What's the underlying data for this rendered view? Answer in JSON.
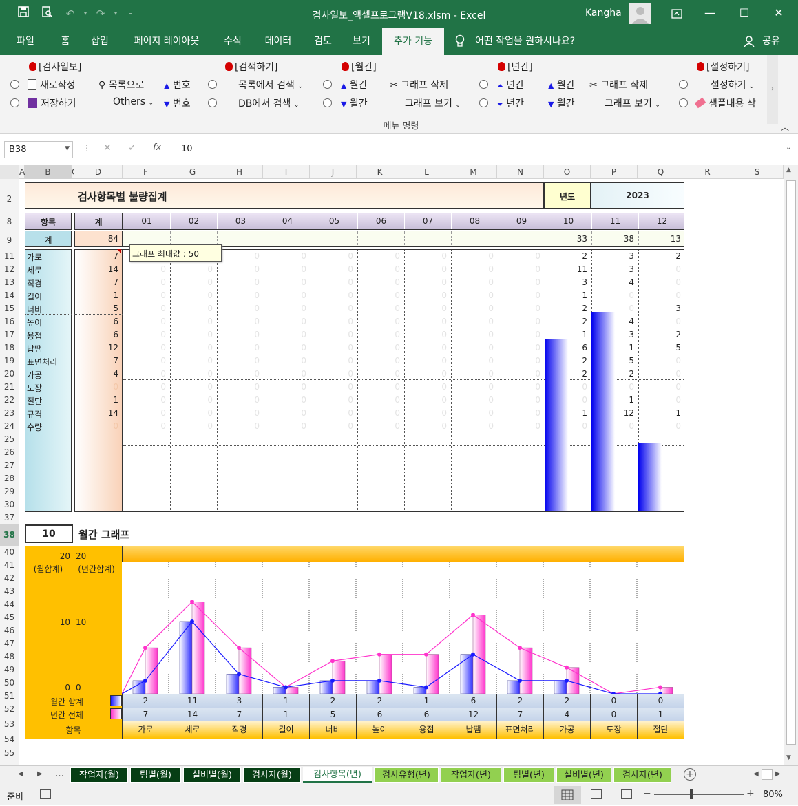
{
  "window": {
    "title": "검사일보_액셀프로그램V18.xlsm  -  Excel",
    "user": "Kangha"
  },
  "tabs": [
    "파일",
    "홈",
    "삽입",
    "페이지 레이아웃",
    "수식",
    "데이터",
    "검토",
    "보기",
    "추가 기능"
  ],
  "tell_me": "어떤 작업을 원하시나요?",
  "share": "공유",
  "ribbon": {
    "group_label": "메뉴 명령",
    "g1": {
      "title": "[검사일보]",
      "new": "새로작성",
      "save": "저장하기",
      "list": "목록으로",
      "others": "Others",
      "num_up": "번호",
      "num_down": "번호"
    },
    "g2": {
      "title": "[검색하기]",
      "list_search": "목록에서 검색",
      "db_search": "DB에서 검색"
    },
    "g3": {
      "title": "[월간]",
      "m_up": "월간",
      "m_down": "월간",
      "del_graph": "그래프 삭제",
      "view_graph": "그래프 보기"
    },
    "g4": {
      "title": "[년간]",
      "y_up": "년간",
      "y_down": "년간",
      "m_up": "월간",
      "m_down": "월간",
      "del_graph": "그래프 삭제",
      "view_graph": "그래프 보기"
    },
    "g5": {
      "title": "[설정하기]",
      "setup": "설정하기",
      "sample": "샘플내용 삭"
    }
  },
  "formula": {
    "namebox": "B38",
    "value": "10",
    "fx": "fx"
  },
  "columns": [
    "A",
    "B",
    "C",
    "D",
    "F",
    "G",
    "H",
    "I",
    "J",
    "K",
    "L",
    "M",
    "N",
    "O",
    "P",
    "Q",
    "R",
    "S"
  ],
  "rows": [
    "1",
    "2",
    "8",
    "9",
    "11",
    "12",
    "13",
    "14",
    "15",
    "16",
    "17",
    "18",
    "19",
    "20",
    "21",
    "22",
    "23",
    "24",
    "25",
    "26",
    "27",
    "28",
    "29",
    "30",
    "37",
    "38",
    "40",
    "41",
    "42",
    "43",
    "44",
    "45",
    "46",
    "47",
    "48",
    "49",
    "50",
    "51",
    "52",
    "53",
    "54",
    "55"
  ],
  "report": {
    "title": "검사항목별 불량집계",
    "year_label": "년도",
    "year": "2023",
    "hdr_item": "항목",
    "hdr_total": "계",
    "months": [
      "01",
      "02",
      "03",
      "04",
      "05",
      "06",
      "07",
      "08",
      "09",
      "10",
      "11",
      "12"
    ],
    "sum_label": "계",
    "sum_total": "84",
    "month_sums": [
      "",
      "",
      "",
      "",
      "",
      "",
      "",
      "",
      "",
      "33",
      "38",
      "13"
    ],
    "tooltip": "그래프 최대값 : 50",
    "items": [
      {
        "name": "가로",
        "total": "7",
        "m": [
          0,
          0,
          0,
          0,
          0,
          0,
          0,
          0,
          0,
          2,
          3,
          2
        ]
      },
      {
        "name": "세로",
        "total": "14",
        "m": [
          0,
          0,
          0,
          0,
          0,
          0,
          0,
          0,
          0,
          11,
          3,
          0
        ]
      },
      {
        "name": "직경",
        "total": "7",
        "m": [
          0,
          0,
          0,
          0,
          0,
          0,
          0,
          0,
          0,
          3,
          4,
          0
        ]
      },
      {
        "name": "길이",
        "total": "1",
        "m": [
          0,
          0,
          0,
          0,
          0,
          0,
          0,
          0,
          0,
          1,
          0,
          0
        ]
      },
      {
        "name": "너비",
        "total": "5",
        "m": [
          0,
          0,
          0,
          0,
          0,
          0,
          0,
          0,
          0,
          2,
          0,
          3
        ]
      },
      {
        "name": "높이",
        "total": "6",
        "m": [
          0,
          0,
          0,
          0,
          0,
          0,
          0,
          0,
          0,
          2,
          4,
          0
        ]
      },
      {
        "name": "용접",
        "total": "6",
        "m": [
          0,
          0,
          0,
          0,
          0,
          0,
          0,
          0,
          0,
          1,
          3,
          2
        ]
      },
      {
        "name": "납땜",
        "total": "12",
        "m": [
          0,
          0,
          0,
          0,
          0,
          0,
          0,
          0,
          0,
          6,
          1,
          5
        ]
      },
      {
        "name": "표면처리",
        "total": "7",
        "m": [
          0,
          0,
          0,
          0,
          0,
          0,
          0,
          0,
          0,
          2,
          5,
          0
        ]
      },
      {
        "name": "가공",
        "total": "4",
        "m": [
          0,
          0,
          0,
          0,
          0,
          0,
          0,
          0,
          0,
          2,
          2,
          0
        ]
      },
      {
        "name": "도장",
        "total": "0",
        "m": [
          0,
          0,
          0,
          0,
          0,
          0,
          0,
          0,
          0,
          0,
          0,
          0
        ]
      },
      {
        "name": "절단",
        "total": "1",
        "m": [
          0,
          0,
          0,
          0,
          0,
          0,
          0,
          0,
          0,
          0,
          1,
          0
        ]
      },
      {
        "name": "규격",
        "total": "14",
        "m": [
          0,
          0,
          0,
          0,
          0,
          0,
          0,
          0,
          0,
          1,
          12,
          1
        ]
      },
      {
        "name": "수량",
        "total": "0",
        "m": [
          0,
          0,
          0,
          0,
          0,
          0,
          0,
          0,
          0,
          0,
          0,
          0
        ]
      }
    ],
    "month_bars": [
      {
        "month": "10",
        "value": 33
      },
      {
        "month": "11",
        "value": 38
      },
      {
        "month": "12",
        "value": 13
      }
    ],
    "bar_max": 50
  },
  "graph": {
    "month": "10",
    "title": "월간 그래프",
    "axis_left": {
      "top": "20",
      "mid": "10",
      "bottom": "0",
      "label": "(월합계)"
    },
    "axis_right": {
      "top": "20",
      "mid": "10",
      "bottom": "0",
      "label": "(년간합계)"
    },
    "row_monthly": "월간 합계",
    "row_yearly": "년간 전체",
    "row_item": "항목",
    "chart_data": {
      "type": "bar",
      "categories": [
        "가로",
        "세로",
        "직경",
        "길이",
        "너비",
        "높이",
        "용접",
        "납땜",
        "표면처리",
        "가공",
        "도장",
        "절단"
      ],
      "series": [
        {
          "name": "월간 합계",
          "values": [
            2,
            11,
            3,
            1,
            2,
            2,
            1,
            6,
            2,
            2,
            0,
            0
          ]
        },
        {
          "name": "년간 전체",
          "values": [
            7,
            14,
            7,
            1,
            5,
            6,
            6,
            12,
            7,
            4,
            0,
            1
          ]
        }
      ],
      "ylim": [
        0,
        20
      ],
      "grid": true,
      "colors": {
        "monthly": "#1a1aff",
        "yearly": "#ff33cc"
      }
    }
  },
  "sheet_tabs": [
    {
      "label": "작업자(월)",
      "style": "dark"
    },
    {
      "label": "팀별(월)",
      "style": "dark"
    },
    {
      "label": "설비별(월)",
      "style": "dark"
    },
    {
      "label": "검사자(월)",
      "style": "dark"
    },
    {
      "label": "검사항목(년)",
      "style": "sel"
    },
    {
      "label": "검사유형(년)",
      "style": "green"
    },
    {
      "label": "작업자(년)",
      "style": "green"
    },
    {
      "label": "팀별(년)",
      "style": "green"
    },
    {
      "label": "설비별(년)",
      "style": "green"
    },
    {
      "label": "검사자(년)",
      "style": "green"
    }
  ],
  "status": {
    "ready": "준비",
    "zoom": "80%"
  }
}
